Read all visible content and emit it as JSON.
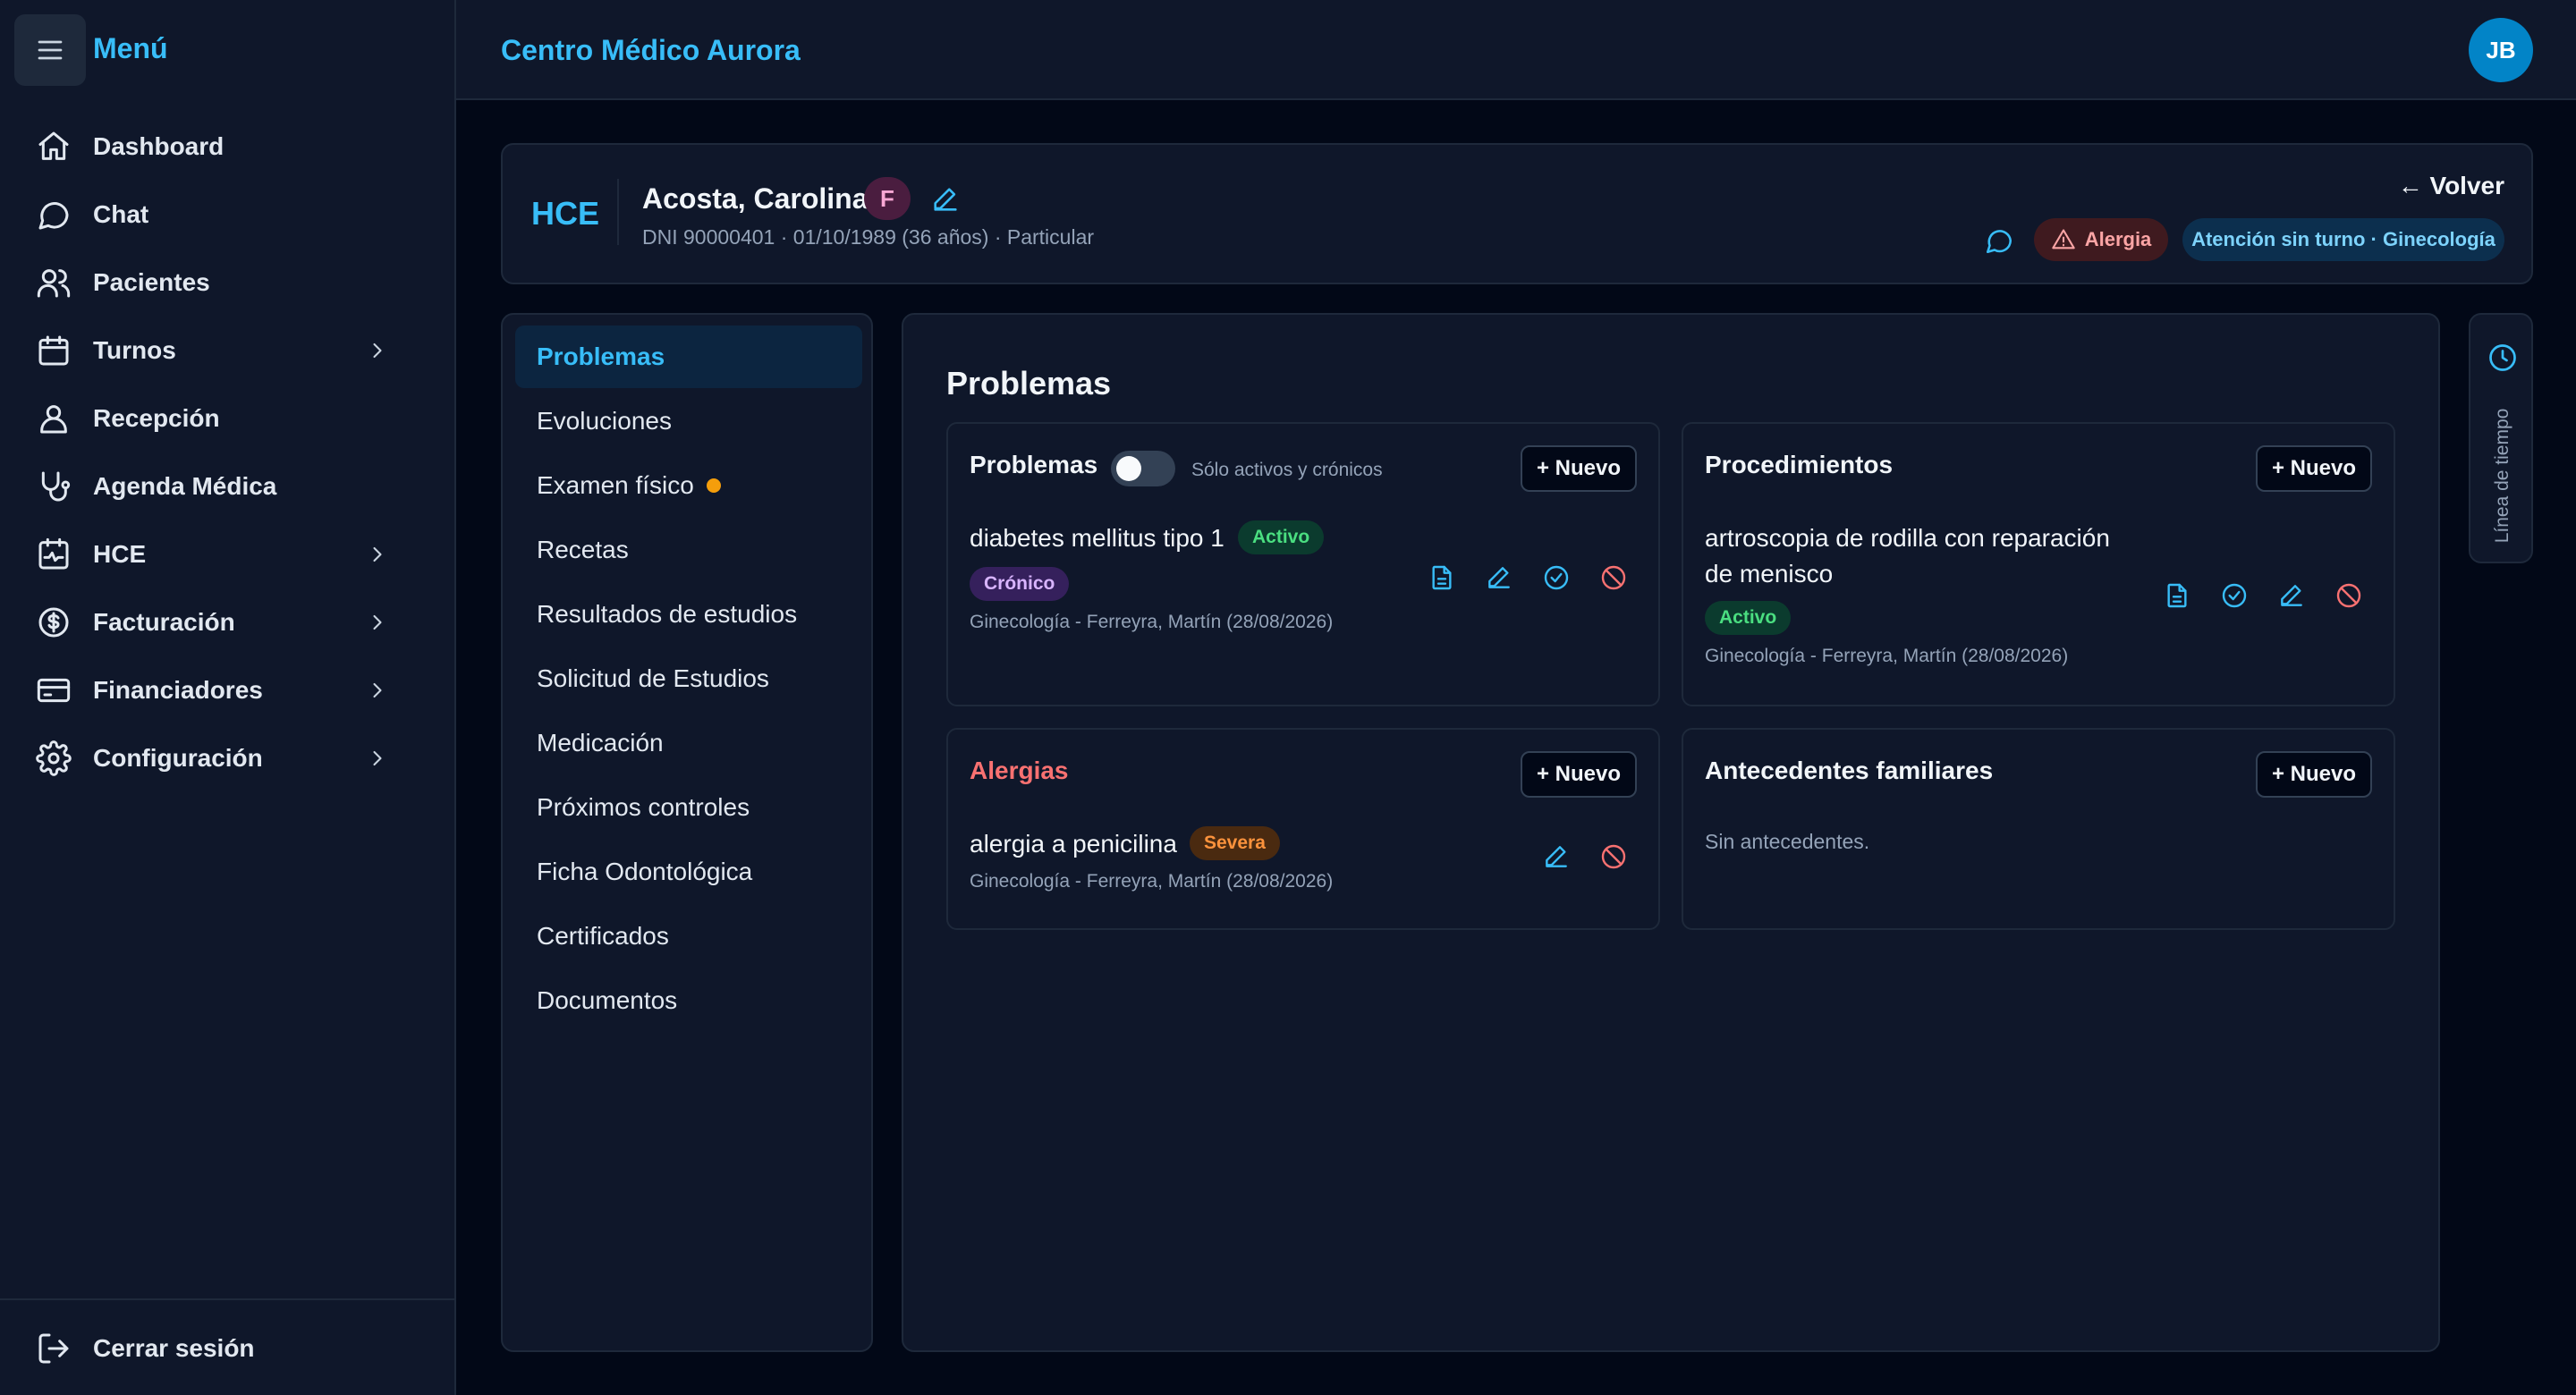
{
  "sidebar": {
    "menu_title": "Menú",
    "items": [
      {
        "label": "Dashboard",
        "icon": "home-icon"
      },
      {
        "label": "Chat",
        "icon": "chat-icon"
      },
      {
        "label": "Pacientes",
        "icon": "users-icon"
      },
      {
        "label": "Turnos",
        "icon": "calendar-icon",
        "has_children": true
      },
      {
        "label": "Recepción",
        "icon": "user-icon"
      },
      {
        "label": "Agenda Médica",
        "icon": "stethoscope-icon"
      },
      {
        "label": "HCE",
        "icon": "heart-calendar-icon",
        "has_children": true
      },
      {
        "label": "Facturación",
        "icon": "dollar-icon",
        "has_children": true
      },
      {
        "label": "Financiadores",
        "icon": "card-icon",
        "has_children": true
      },
      {
        "label": "Configuración",
        "icon": "gear-icon",
        "has_children": true
      }
    ],
    "logout_label": "Cerrar sesión"
  },
  "topbar": {
    "brand": "Centro Médico Aurora",
    "avatar_initials": "JB"
  },
  "patient": {
    "section_label": "HCE",
    "name": "Acosta, Carolina",
    "sex": "F",
    "meta": "DNI 90000401 · 01/10/1989 (36 años) · Particular",
    "back_label": "← Volver",
    "allergy_badge": "Alergia",
    "attention_badge": "Atención sin turno · Ginecología"
  },
  "sections": [
    {
      "label": "Problemas",
      "active": true
    },
    {
      "label": "Evoluciones"
    },
    {
      "label": "Examen físico",
      "dot": true
    },
    {
      "label": "Recetas"
    },
    {
      "label": "Resultados de estudios"
    },
    {
      "label": "Solicitud de Estudios"
    },
    {
      "label": "Medicación"
    },
    {
      "label": "Próximos controles"
    },
    {
      "label": "Ficha Odontológica"
    },
    {
      "label": "Certificados"
    },
    {
      "label": "Documentos"
    }
  ],
  "main": {
    "title": "Problemas",
    "new_label": "+ Nuevo",
    "problems": {
      "title": "Problemas",
      "toggle_label": "Sólo activos y crónicos",
      "toggle_on": false,
      "item": {
        "name": "diabetes mellitus tipo 1",
        "status": "Activo",
        "tag": "Crónico",
        "meta": "Ginecología - Ferreyra, Martín (28/08/2026)"
      }
    },
    "procedures": {
      "title": "Procedimientos",
      "item": {
        "name_line1": "artroscopia de rodilla con reparación",
        "name_line2": "de menisco",
        "status": "Activo",
        "meta": "Ginecología - Ferreyra, Martín (28/08/2026)"
      }
    },
    "allergies": {
      "title": "Alergias",
      "item": {
        "name": "alergia a penicilina",
        "severity": "Severa",
        "meta": "Ginecología - Ferreyra, Martín (28/08/2026)"
      }
    },
    "family_history": {
      "title": "Antecedentes familiares",
      "empty": "Sin antecedentes."
    }
  },
  "timeline": {
    "label": "Línea de tiempo"
  },
  "colors": {
    "accent": "#38bdf8",
    "background": "#020817",
    "panel": "#0f172a",
    "danger": "#f87171",
    "success": "#4ade80",
    "warning": "#f59e0b"
  }
}
